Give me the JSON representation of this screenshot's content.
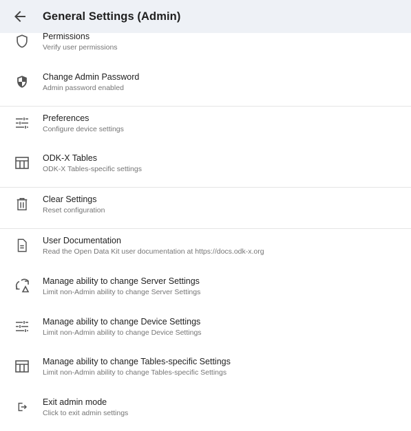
{
  "header": {
    "title": "General Settings (Admin)"
  },
  "items": [
    {
      "title": "Permissions",
      "subtitle": "Verify user permissions"
    },
    {
      "title": "Change Admin Password",
      "subtitle": "Admin password enabled"
    },
    {
      "title": "Preferences",
      "subtitle": "Configure device settings"
    },
    {
      "title": "ODK-X Tables",
      "subtitle": "ODK-X Tables-specific settings"
    },
    {
      "title": "Clear Settings",
      "subtitle": "Reset configuration"
    },
    {
      "title": "User Documentation",
      "subtitle": "Read the Open Data Kit user documentation at https://docs.odk-x.org"
    },
    {
      "title": "Manage ability to change Server Settings",
      "subtitle": "Limit non-Admin ability to change Server Settings"
    },
    {
      "title": "Manage ability to change Device Settings",
      "subtitle": "Limit non-Admin ability to change Device Settings"
    },
    {
      "title": "Manage ability to change Tables-specific Settings",
      "subtitle": "Limit non-Admin ability to change Tables-specific Settings"
    },
    {
      "title": "Exit admin mode",
      "subtitle": "Click to exit admin settings"
    }
  ]
}
